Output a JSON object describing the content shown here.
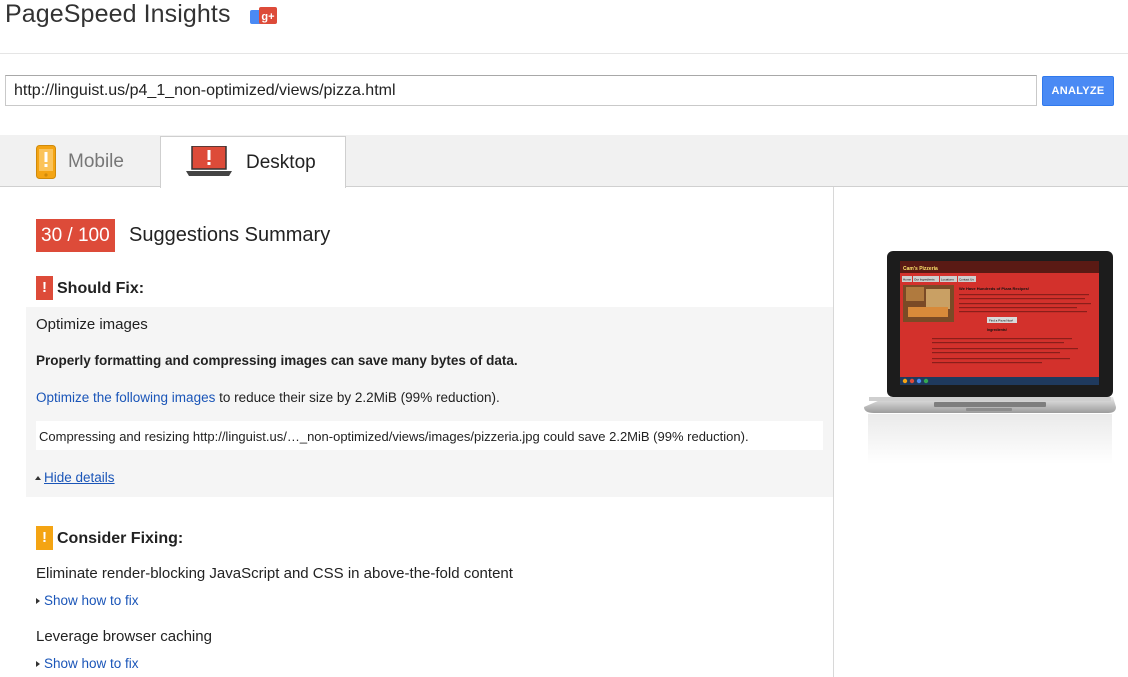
{
  "header": {
    "title": "PageSpeed Insights",
    "gplus_icon": "google-plus-icon",
    "gplus_text": "g+"
  },
  "url_bar": {
    "value": "http://linguist.us/p4_1_non-optimized/views/pizza.html",
    "analyze_label": "ANALYZE"
  },
  "tabs": [
    {
      "label": "Mobile",
      "icon": "phone-icon",
      "active": false
    },
    {
      "label": "Desktop",
      "icon": "laptop-icon",
      "active": true
    }
  ],
  "summary": {
    "score": "30 / 100",
    "title": "Suggestions Summary"
  },
  "should_fix": {
    "marker": "!",
    "label": "Should Fix:",
    "rule": {
      "title": "Optimize images",
      "summary": "Properly formatting and compressing images can save many bytes of data.",
      "link_text": "Optimize the following images",
      "line_rest": " to reduce their size by 2.2MiB (99% reduction).",
      "detail": "Compressing and resizing http://linguist.us/…_non-optimized/views/images/pizzeria.jpg could save 2.2MiB (99% reduction).",
      "toggle_label": "Hide details"
    }
  },
  "consider_fixing": {
    "marker": "!",
    "label": "Consider Fixing:",
    "items": [
      {
        "title": "Eliminate render-blocking JavaScript and CSS in above-the-fold content",
        "link": "Show how to fix"
      },
      {
        "title": "Leverage browser caching",
        "link": "Show how to fix"
      }
    ]
  },
  "preview": {
    "site_title": "Cam's Pizzeria",
    "headline": "We Have Hundreds of Pizza Recipes!",
    "nav": [
      "Home",
      "Our Ingredients",
      "Locations",
      "Contact Us"
    ],
    "button": "Find a Pizza Now!",
    "section": "Ingredients!",
    "colors": {
      "page_bg": "#d3312c",
      "header_bg": "#5a1a14"
    }
  },
  "colors": {
    "danger": "#dd4b39",
    "warning": "#f4a413",
    "accent": "#4a8af4",
    "link": "#1a55b8"
  }
}
